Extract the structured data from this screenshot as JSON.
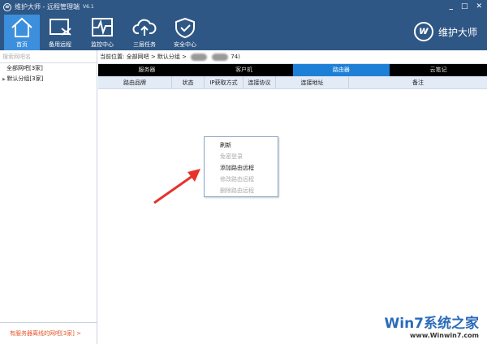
{
  "app": {
    "title": "维护大师 - 远程管理端",
    "version": "V6.1",
    "brand": "维护大师"
  },
  "window": {
    "minimize": "_",
    "maximize": "□",
    "close": "✕"
  },
  "toolbar": [
    {
      "label": "首页",
      "icon": "home-icon"
    },
    {
      "label": "备用远程",
      "icon": "remote-screen-icon"
    },
    {
      "label": "监控中心",
      "icon": "monitor-icon"
    },
    {
      "label": "三层任务",
      "icon": "cloud-upload-icon"
    },
    {
      "label": "安全中心",
      "icon": "shield-check-icon"
    }
  ],
  "sidebar": {
    "search_placeholder": "搜索网吧名",
    "tree": [
      "全部网吧[3家]",
      "默认分组[3家]"
    ],
    "footer": "有服务器离线的网吧[3家] >"
  },
  "breadcrumb": {
    "prefix": "当前位置:",
    "items": [
      "全部网吧",
      "默认分组"
    ],
    "suffix": "74)"
  },
  "tabs": [
    {
      "label": "服务器"
    },
    {
      "label": "客户机"
    },
    {
      "label": "路由器",
      "active": true
    },
    {
      "label": "云笔记"
    }
  ],
  "columns": [
    "路由品牌",
    "状态",
    "IP获取方式",
    "连接协议",
    "连接地址",
    "备注"
  ],
  "context_menu": [
    {
      "label": "刷新",
      "enabled": true
    },
    {
      "label": "免密登录",
      "enabled": false
    },
    {
      "label": "添加路由远程",
      "enabled": true
    },
    {
      "label": "修改路由远程",
      "enabled": false
    },
    {
      "label": "删除路由远程",
      "enabled": false
    }
  ],
  "watermark": {
    "line1": "Win7系统之家",
    "line2": "www.Winwin7.com"
  }
}
